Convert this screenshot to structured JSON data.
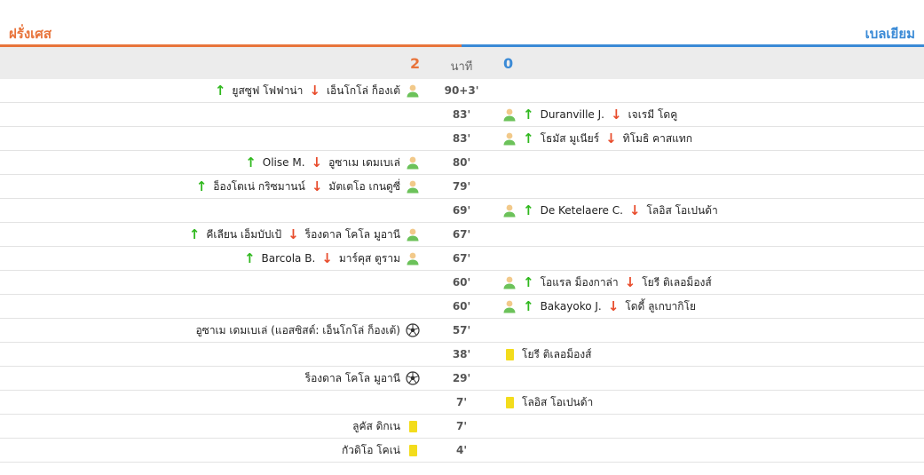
{
  "home_team": "ฝรั่งเศส",
  "away_team": "เบลเยียม",
  "score": {
    "home": "2",
    "label": "นาที",
    "away": "0"
  },
  "colors": {
    "home": "#e8743b",
    "away": "#3a8ad6",
    "sub_in": "#2fb81d",
    "sub_out": "#e84c2c",
    "yellow_card": "#f3dc1c"
  },
  "events": [
    {
      "minute": "90+3'",
      "home": {
        "in": "ยูสซูฟ โฟฟาน่า",
        "out": "เอ็นโกโล่ ก็องเต้"
      }
    },
    {
      "minute": "83'",
      "away": {
        "in": "Duranville J.",
        "out": "เจเรมี โดคู"
      }
    },
    {
      "minute": "83'",
      "away": {
        "in": "โธมัส มูเนียร์",
        "out": "ทิโมธิ คาสแทก"
      }
    },
    {
      "minute": "80'",
      "home": {
        "in": "Olise M.",
        "out": "อูซาเม เดมเบเล่"
      }
    },
    {
      "minute": "79'",
      "home": {
        "in": "อ็องโตเน่ กริซมานน์",
        "out": "มัตเตโอ เกนดูซี่"
      }
    },
    {
      "minute": "69'",
      "away": {
        "in": "De Ketelaere C.",
        "out": "โลอิส โอเปนด้า"
      }
    },
    {
      "minute": "67'",
      "home": {
        "in": "คีเลียน เอ็มบัปเป้",
        "out": "ร็องดาล โคโล มูอานี"
      }
    },
    {
      "minute": "67'",
      "home": {
        "in": "Barcola B.",
        "out": "มาร์คุส ตูราม"
      }
    },
    {
      "minute": "60'",
      "away": {
        "in": "โอแรล ม็องกาล่า",
        "out": "โยรี ติเลอม็องส์"
      }
    },
    {
      "minute": "60'",
      "away": {
        "in": "Bakayoko J.",
        "out": "โดดี้ ลูเกบากิโย"
      }
    },
    {
      "minute": "57'",
      "home": {
        "goal": "อูซาเม เดมเบเล่ (แอสซิสต์: เอ็นโกโล่ ก็องเต้)"
      }
    },
    {
      "minute": "38'",
      "away": {
        "card": "โยรี ติเลอม็องส์"
      }
    },
    {
      "minute": "29'",
      "home": {
        "goal": "ร็องดาล โคโล มูอานี"
      }
    },
    {
      "minute": "7'",
      "away": {
        "card": "โลอิส โอเปนด้า"
      }
    },
    {
      "minute": "7'",
      "home": {
        "card": "ลูคัส ดิกเน"
      }
    },
    {
      "minute": "4'",
      "home": {
        "card": "กัวดิโอ โคเน่"
      }
    }
  ]
}
